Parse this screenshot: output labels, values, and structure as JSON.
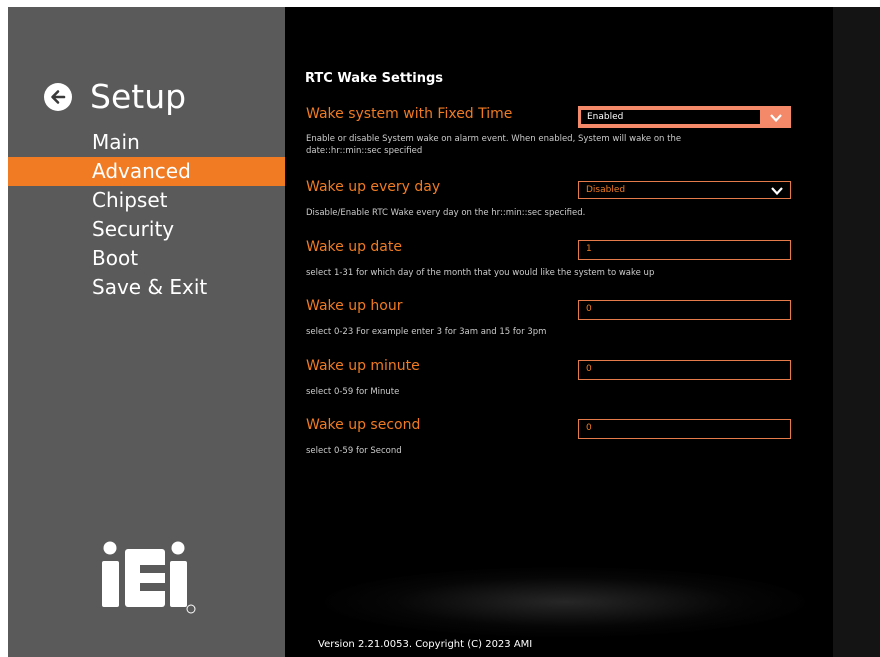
{
  "sidebar": {
    "title": "Setup",
    "nav": [
      "Main",
      "Advanced",
      "Chipset",
      "Security",
      "Boot",
      "Save & Exit"
    ],
    "active_index": 1,
    "logo_text": "iEi",
    "logo_mark": "®"
  },
  "main": {
    "section_title": "RTC Wake Settings",
    "items": [
      {
        "label": "Wake system with Fixed Time",
        "value": "Enabled",
        "help": "Enable or disable System wake on alarm event. When enabled, System will wake on the date::hr::min::sec specified"
      },
      {
        "label": "Wake up every day",
        "value": "Disabled",
        "help": "Disable/Enable RTC Wake every day on the hr::min::sec specified."
      },
      {
        "label": "Wake up date",
        "value": "1",
        "help": "select 1-31 for which day of the month that you would like the system to wake up"
      },
      {
        "label": "Wake up hour",
        "value": "0",
        "help": "select 0-23 For example enter 3 for 3am and 15 for 3pm"
      },
      {
        "label": "Wake up minute",
        "value": "0",
        "help": "select 0-59 for Minute"
      },
      {
        "label": "Wake up second",
        "value": "0",
        "help": "select 0-59 for Second"
      }
    ],
    "version": "Version 2.21.0053. Copyright (C) 2023 AMI"
  },
  "colors": {
    "accent": "#f07b22",
    "selected_field": "#f4896a",
    "sidebar_bg": "#5a5a5a",
    "main_bg": "#000000"
  }
}
